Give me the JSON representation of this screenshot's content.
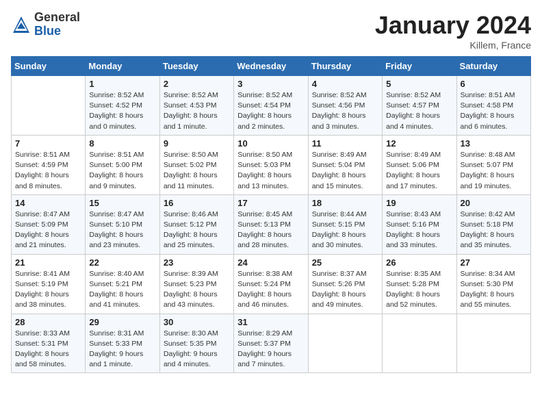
{
  "logo": {
    "general": "General",
    "blue": "Blue"
  },
  "header": {
    "month": "January 2024",
    "location": "Killem, France"
  },
  "days_of_week": [
    "Sunday",
    "Monday",
    "Tuesday",
    "Wednesday",
    "Thursday",
    "Friday",
    "Saturday"
  ],
  "weeks": [
    [
      {
        "day": "",
        "info": ""
      },
      {
        "day": "1",
        "info": "Sunrise: 8:52 AM\nSunset: 4:52 PM\nDaylight: 8 hours\nand 0 minutes."
      },
      {
        "day": "2",
        "info": "Sunrise: 8:52 AM\nSunset: 4:53 PM\nDaylight: 8 hours\nand 1 minute."
      },
      {
        "day": "3",
        "info": "Sunrise: 8:52 AM\nSunset: 4:54 PM\nDaylight: 8 hours\nand 2 minutes."
      },
      {
        "day": "4",
        "info": "Sunrise: 8:52 AM\nSunset: 4:56 PM\nDaylight: 8 hours\nand 3 minutes."
      },
      {
        "day": "5",
        "info": "Sunrise: 8:52 AM\nSunset: 4:57 PM\nDaylight: 8 hours\nand 4 minutes."
      },
      {
        "day": "6",
        "info": "Sunrise: 8:51 AM\nSunset: 4:58 PM\nDaylight: 8 hours\nand 6 minutes."
      }
    ],
    [
      {
        "day": "7",
        "info": "Sunrise: 8:51 AM\nSunset: 4:59 PM\nDaylight: 8 hours\nand 8 minutes."
      },
      {
        "day": "8",
        "info": "Sunrise: 8:51 AM\nSunset: 5:00 PM\nDaylight: 8 hours\nand 9 minutes."
      },
      {
        "day": "9",
        "info": "Sunrise: 8:50 AM\nSunset: 5:02 PM\nDaylight: 8 hours\nand 11 minutes."
      },
      {
        "day": "10",
        "info": "Sunrise: 8:50 AM\nSunset: 5:03 PM\nDaylight: 8 hours\nand 13 minutes."
      },
      {
        "day": "11",
        "info": "Sunrise: 8:49 AM\nSunset: 5:04 PM\nDaylight: 8 hours\nand 15 minutes."
      },
      {
        "day": "12",
        "info": "Sunrise: 8:49 AM\nSunset: 5:06 PM\nDaylight: 8 hours\nand 17 minutes."
      },
      {
        "day": "13",
        "info": "Sunrise: 8:48 AM\nSunset: 5:07 PM\nDaylight: 8 hours\nand 19 minutes."
      }
    ],
    [
      {
        "day": "14",
        "info": "Sunrise: 8:47 AM\nSunset: 5:09 PM\nDaylight: 8 hours\nand 21 minutes."
      },
      {
        "day": "15",
        "info": "Sunrise: 8:47 AM\nSunset: 5:10 PM\nDaylight: 8 hours\nand 23 minutes."
      },
      {
        "day": "16",
        "info": "Sunrise: 8:46 AM\nSunset: 5:12 PM\nDaylight: 8 hours\nand 25 minutes."
      },
      {
        "day": "17",
        "info": "Sunrise: 8:45 AM\nSunset: 5:13 PM\nDaylight: 8 hours\nand 28 minutes."
      },
      {
        "day": "18",
        "info": "Sunrise: 8:44 AM\nSunset: 5:15 PM\nDaylight: 8 hours\nand 30 minutes."
      },
      {
        "day": "19",
        "info": "Sunrise: 8:43 AM\nSunset: 5:16 PM\nDaylight: 8 hours\nand 33 minutes."
      },
      {
        "day": "20",
        "info": "Sunrise: 8:42 AM\nSunset: 5:18 PM\nDaylight: 8 hours\nand 35 minutes."
      }
    ],
    [
      {
        "day": "21",
        "info": "Sunrise: 8:41 AM\nSunset: 5:19 PM\nDaylight: 8 hours\nand 38 minutes."
      },
      {
        "day": "22",
        "info": "Sunrise: 8:40 AM\nSunset: 5:21 PM\nDaylight: 8 hours\nand 41 minutes."
      },
      {
        "day": "23",
        "info": "Sunrise: 8:39 AM\nSunset: 5:23 PM\nDaylight: 8 hours\nand 43 minutes."
      },
      {
        "day": "24",
        "info": "Sunrise: 8:38 AM\nSunset: 5:24 PM\nDaylight: 8 hours\nand 46 minutes."
      },
      {
        "day": "25",
        "info": "Sunrise: 8:37 AM\nSunset: 5:26 PM\nDaylight: 8 hours\nand 49 minutes."
      },
      {
        "day": "26",
        "info": "Sunrise: 8:35 AM\nSunset: 5:28 PM\nDaylight: 8 hours\nand 52 minutes."
      },
      {
        "day": "27",
        "info": "Sunrise: 8:34 AM\nSunset: 5:30 PM\nDaylight: 8 hours\nand 55 minutes."
      }
    ],
    [
      {
        "day": "28",
        "info": "Sunrise: 8:33 AM\nSunset: 5:31 PM\nDaylight: 8 hours\nand 58 minutes."
      },
      {
        "day": "29",
        "info": "Sunrise: 8:31 AM\nSunset: 5:33 PM\nDaylight: 9 hours\nand 1 minute."
      },
      {
        "day": "30",
        "info": "Sunrise: 8:30 AM\nSunset: 5:35 PM\nDaylight: 9 hours\nand 4 minutes."
      },
      {
        "day": "31",
        "info": "Sunrise: 8:29 AM\nSunset: 5:37 PM\nDaylight: 9 hours\nand 7 minutes."
      },
      {
        "day": "",
        "info": ""
      },
      {
        "day": "",
        "info": ""
      },
      {
        "day": "",
        "info": ""
      }
    ]
  ]
}
